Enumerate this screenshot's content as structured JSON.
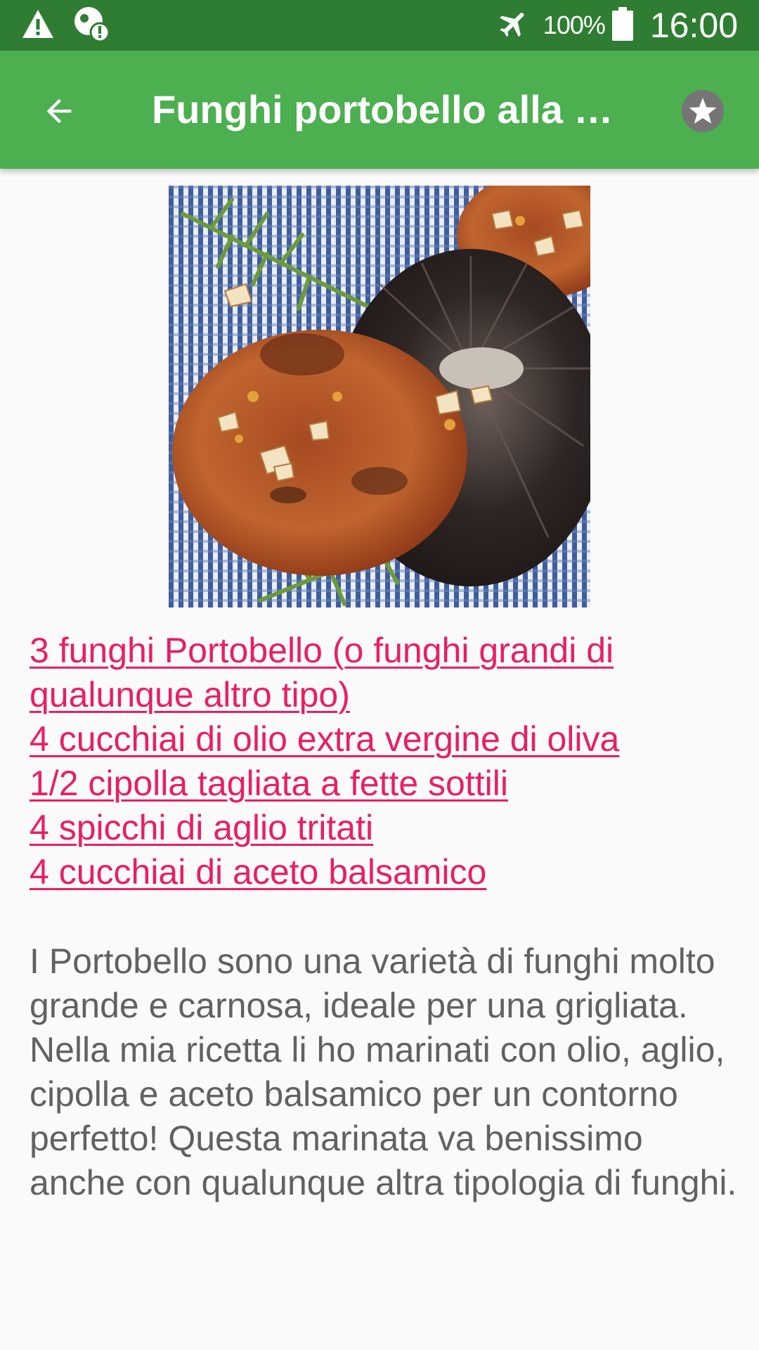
{
  "status_bar": {
    "icons": [
      "warning-icon",
      "location-alert-icon",
      "airplane-mode-icon",
      "battery-icon"
    ],
    "battery_percent": "100%",
    "time": "16:00"
  },
  "app_bar": {
    "back_icon": "arrow-back-icon",
    "title": "Funghi portobello alla g…",
    "favorite_icon": "star-icon",
    "background_color": "#4caf50",
    "status_color": "#2e7d32"
  },
  "recipe": {
    "image_icon": "photo-grilled-portobello-mushrooms",
    "ingredients": [
      "3 funghi Portobello (o funghi grandi di qualunque altro tipo)",
      "4 cucchiai di olio extra vergine di oliva",
      "1/2 cipolla tagliata a fette sottili",
      "4 spicchi di aglio tritati",
      "4 cucchiai di aceto balsamico"
    ],
    "link_color": "#e91e63",
    "description": "I Portobello sono una varietà di funghi molto grande e carnosa, ideale per una grigliata. Nella mia ricetta li ho marinati con olio, aglio, cipolla e aceto balsamico per un contorno perfetto! Questa marinata va benissimo anche con qualunque altra tipologia di funghi."
  }
}
